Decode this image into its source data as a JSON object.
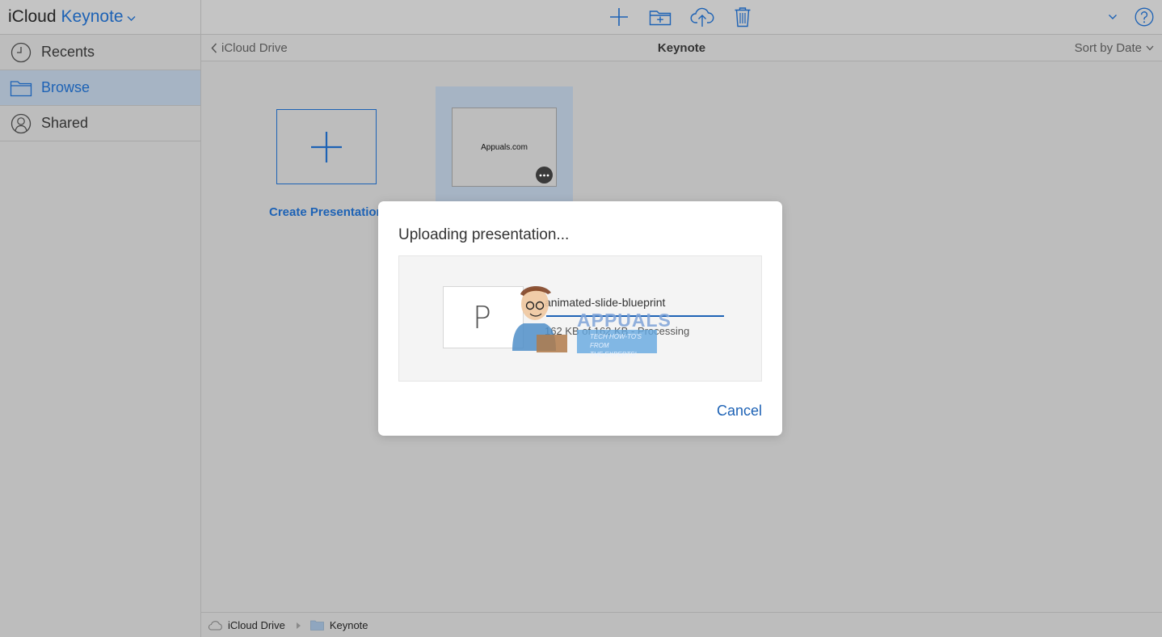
{
  "brand": {
    "prefix": "iCloud",
    "app": "Keynote"
  },
  "toolbar": {
    "icons": [
      "plus-icon",
      "new-folder-icon",
      "upload-icon",
      "trash-icon",
      "chevron-down-icon",
      "help-icon"
    ]
  },
  "sidebar": {
    "items": [
      {
        "label": "Recents",
        "icon": "clock-icon",
        "active": false
      },
      {
        "label": "Browse",
        "icon": "folder-icon",
        "active": true
      },
      {
        "label": "Shared",
        "icon": "person-icon",
        "active": false
      }
    ]
  },
  "subbar": {
    "back_label": "iCloud Drive",
    "title": "Keynote",
    "sort_label": "Sort by Date"
  },
  "content": {
    "create_label": "Create Presentation",
    "document_thumb_text": "Appuals.com"
  },
  "footer": {
    "root": "iCloud Drive",
    "folder": "Keynote"
  },
  "modal": {
    "title": "Uploading presentation...",
    "file_letter": "P",
    "file_name": "animated-slide-blueprint",
    "status": "162 KB of 162 KB - Processing",
    "progress": 1.0,
    "cancel_label": "Cancel"
  },
  "watermark": {
    "title": "APPUALS",
    "line1": "TECH HOW-TO'S FROM",
    "line2": "THE EXPERTS!"
  },
  "colors": {
    "accent": "#1d62b5",
    "background": "#bdbdbd",
    "sidebar_active": "#a6b4c4"
  }
}
